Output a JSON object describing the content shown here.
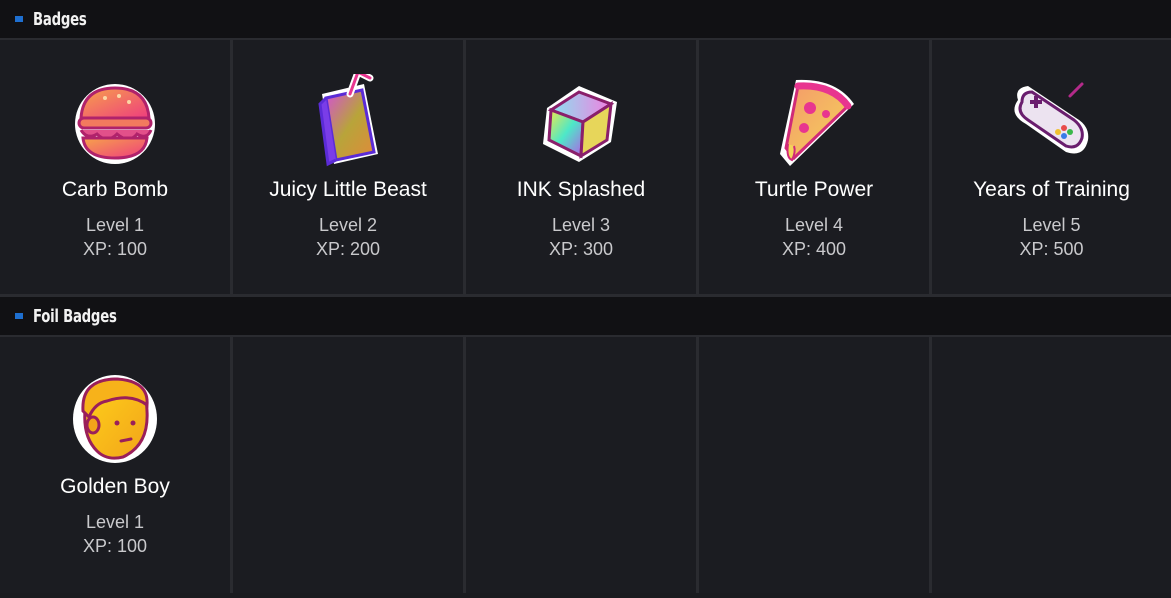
{
  "sections": [
    {
      "title": "Badges",
      "badges": [
        {
          "name": "Carb Bomb",
          "level": "Level 1",
          "xp": "XP: 100",
          "icon": "burger-icon"
        },
        {
          "name": "Juicy Little Beast",
          "level": "Level 2",
          "xp": "XP: 200",
          "icon": "juice-box-icon"
        },
        {
          "name": "INK Splashed",
          "level": "Level 3",
          "xp": "XP: 300",
          "icon": "cube-icon"
        },
        {
          "name": "Turtle Power",
          "level": "Level 4",
          "xp": "XP: 400",
          "icon": "pizza-slice-icon"
        },
        {
          "name": "Years of Training",
          "level": "Level 5",
          "xp": "XP: 500",
          "icon": "gamepad-icon"
        }
      ]
    },
    {
      "title": "Foil Badges",
      "badges": [
        {
          "name": "Golden Boy",
          "level": "Level 1",
          "xp": "XP: 100",
          "icon": "golden-face-icon"
        }
      ]
    }
  ],
  "colors": {
    "accent": "#1e6fd0",
    "background": "#1a1b1f",
    "header_background": "#111114",
    "divider": "#2a2b30"
  }
}
